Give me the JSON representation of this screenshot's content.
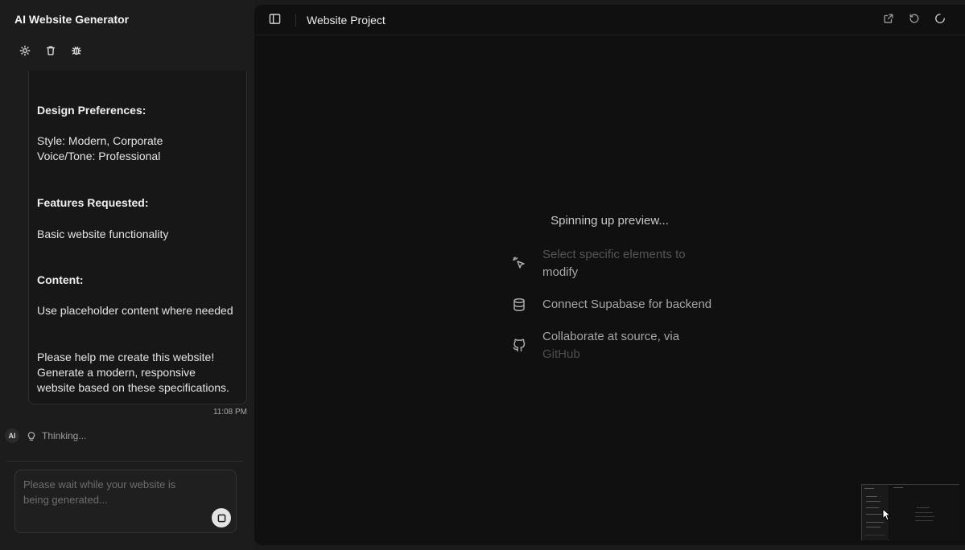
{
  "sidebar": {
    "app_title": "AI Website Generator",
    "toolbar": [
      {
        "name": "theme-icon"
      },
      {
        "name": "trash-icon"
      },
      {
        "name": "bug-icon"
      }
    ]
  },
  "message": {
    "design_heading": "Design Preferences:",
    "style_line": "Style: Modern, Corporate",
    "voice_line": "Voice/Tone: Professional",
    "features_heading": "Features Requested:",
    "features_text": "Basic website functionality",
    "content_heading": "Content:",
    "content_text": "Use placeholder content where needed",
    "closing_text": "Please help me create this website! Generate a modern, responsive website based on these specifications.",
    "timestamp": "11:08 PM"
  },
  "ai_status": {
    "avatar": "AI",
    "status_text": "Thinking..."
  },
  "chat_input": {
    "placeholder": "Please wait while your website is being generated..."
  },
  "preview": {
    "project_title": "Website Project",
    "status_text": "Spinning up preview...",
    "tips": [
      {
        "line1": "Select specific elements to",
        "line2": "modify",
        "icon": "pointer-click-icon"
      },
      {
        "line1": "Connect Supabase for backend",
        "icon": "database-icon"
      },
      {
        "line1": "Collaborate at source, via",
        "line2": "GitHub",
        "icon": "github-icon"
      }
    ]
  }
}
